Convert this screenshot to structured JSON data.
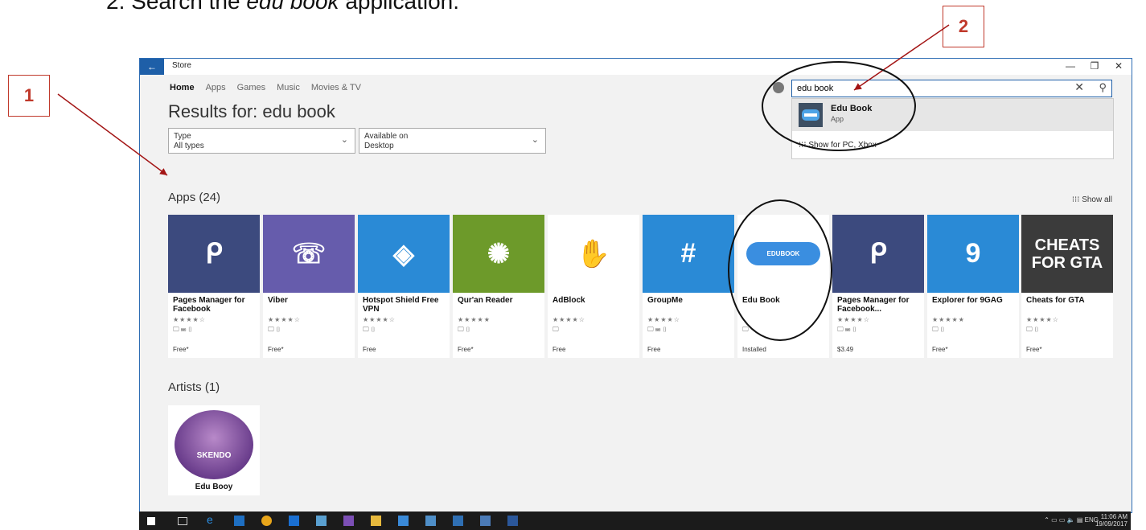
{
  "caption": {
    "number": "2.",
    "prefix": "Search the ",
    "italic": "edu book",
    "suffix": " application."
  },
  "callouts": {
    "one": "1",
    "two": "2"
  },
  "window": {
    "title": "Store",
    "back_icon": "back-arrow-icon",
    "controls": {
      "minimize": "—",
      "restore": "❐",
      "close": "✕"
    }
  },
  "nav": {
    "items": [
      "Home",
      "Apps",
      "Games",
      "Music",
      "Movies & TV"
    ],
    "active": "Home"
  },
  "results_title": "Results for:  edu book",
  "filters": [
    {
      "label": "Type",
      "value": "All types"
    },
    {
      "label": "Available on",
      "value": "Desktop"
    }
  ],
  "search": {
    "value": "edu book",
    "clear": "✕",
    "search_icon": "⚲"
  },
  "suggestion": {
    "name": "Edu Book",
    "type": "App",
    "show_for": "Show for PC, Xbox"
  },
  "apps": {
    "heading": "Apps (24)",
    "show_all": "Show all",
    "items": [
      {
        "name": "Pages Manager for Facebook",
        "rating": "★★★★☆",
        "devices": "🖵 ⌨ ▯",
        "price": "Free*",
        "color": "#3c4a7e",
        "glyph": "ᑭ"
      },
      {
        "name": "Viber",
        "rating": "★★★★☆",
        "devices": "🖵 ▯",
        "price": "Free*",
        "color": "#665cac",
        "glyph": "☏"
      },
      {
        "name": "Hotspot Shield Free VPN",
        "rating": "★★★★☆",
        "devices": "🖵 ▯",
        "price": "Free",
        "color": "#2a8ad6",
        "glyph": "◈"
      },
      {
        "name": "Qur'an Reader",
        "rating": "★★★★★",
        "devices": "🖵 ▯",
        "price": "Free*",
        "color": "#6d9a2a",
        "glyph": "✺"
      },
      {
        "name": "AdBlock",
        "rating": "★★★★☆",
        "devices": "🖵",
        "price": "Free",
        "color": "#ffffff",
        "glyph": "✋"
      },
      {
        "name": "GroupMe",
        "rating": "★★★★☆",
        "devices": "🖵 ⌨ ▯",
        "price": "Free",
        "color": "#2a8ad6",
        "glyph": "#"
      },
      {
        "name": "Edu Book",
        "rating": "",
        "devices": "🖵",
        "price": "Installed",
        "color": "#ffffff",
        "glyph": "EDUBOOK"
      },
      {
        "name": "Pages Manager for Facebook...",
        "rating": "★★★★☆",
        "devices": "🖵 ⌨ ▯",
        "price": "$3.49",
        "color": "#3c4a7e",
        "glyph": "ᑭ"
      },
      {
        "name": "Explorer for 9GAG",
        "rating": "★★★★★",
        "devices": "🖵 ▯",
        "price": "Free*",
        "color": "#2a8ad6",
        "glyph": "9"
      },
      {
        "name": "Cheats for GTA",
        "rating": "★★★★☆",
        "devices": "🖵 ▯",
        "price": "Free*",
        "color": "#3b3b3b",
        "glyph": "CHEATS FOR GTA"
      }
    ]
  },
  "artists": {
    "heading": "Artists (1)",
    "items": [
      {
        "name": "Edu Booy",
        "image_text": "SKENDO"
      }
    ]
  },
  "taskbar": {
    "tray": "ENG",
    "time": "11:06 AM",
    "date": "19/09/2017"
  }
}
